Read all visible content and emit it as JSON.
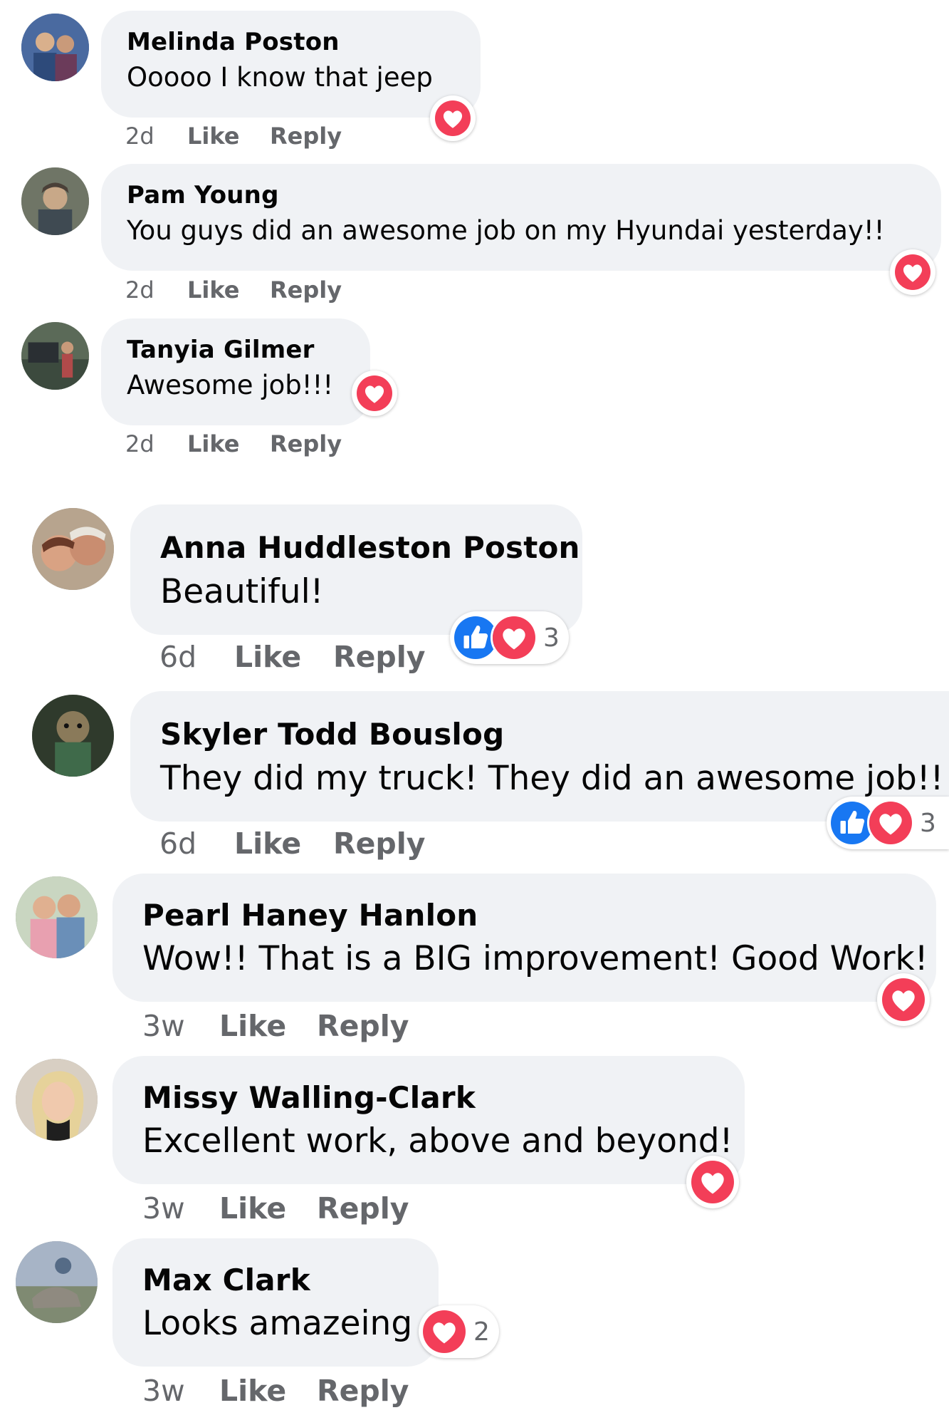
{
  "colors": {
    "bubble": "#f0f2f5",
    "meta": "#65676b",
    "love": "#f33e58",
    "like": "#1877f2"
  },
  "comments": [
    {
      "author": "Melinda Poston",
      "text": "Ooooo I know that jeep",
      "time": "2d",
      "like": "Like",
      "reply": "Reply",
      "reactions": [
        "love-icon"
      ]
    },
    {
      "author": "Pam Young",
      "text": "You guys did an awesome job on my Hyundai yesterday!!",
      "time": "2d",
      "like": "Like",
      "reply": "Reply",
      "reactions": [
        "love-icon"
      ]
    },
    {
      "author": "Tanyia Gilmer",
      "text": "Awesome job!!!",
      "time": "2d",
      "like": "Like",
      "reply": "Reply",
      "reactions": [
        "love-icon"
      ]
    },
    {
      "author": "Anna Huddleston Poston",
      "text": "Beautiful!",
      "time": "6d",
      "like": "Like",
      "reply": "Reply",
      "reactions": [
        "like-icon",
        "love-icon"
      ],
      "count": "3"
    },
    {
      "author": "Skyler Todd Bouslog",
      "text": "They did my truck! They did an awesome job!!",
      "time": "6d",
      "like": "Like",
      "reply": "Reply",
      "reactions": [
        "like-icon",
        "love-icon"
      ],
      "count": "3"
    },
    {
      "author": "Pearl Haney Hanlon",
      "text": "Wow!! That is a BIG improvement! Good Work!",
      "time": "3w",
      "like": "Like",
      "reply": "Reply",
      "reactions": [
        "love-icon"
      ]
    },
    {
      "author": "Missy Walling-Clark",
      "text": "Excellent work, above and beyond!",
      "time": "3w",
      "like": "Like",
      "reply": "Reply",
      "reactions": [
        "love-icon"
      ]
    },
    {
      "author": "Max Clark",
      "text": "Looks amazeing",
      "time": "3w",
      "like": "Like",
      "reply": "Reply",
      "reactions": [
        "love-icon"
      ],
      "count": "2"
    }
  ]
}
